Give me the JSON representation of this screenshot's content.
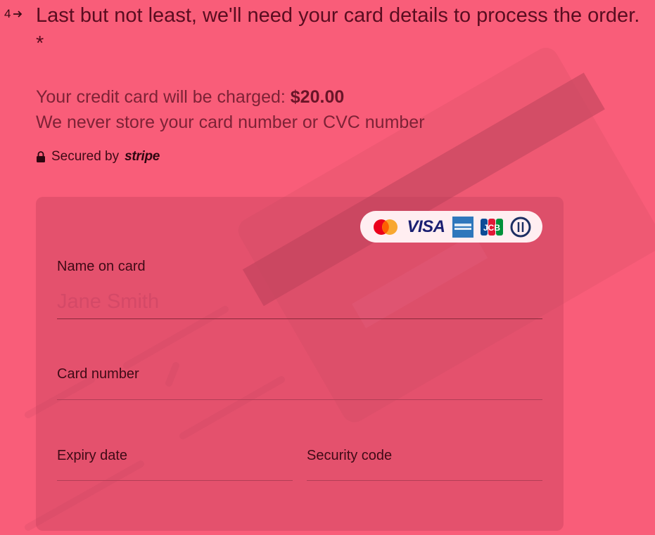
{
  "question": {
    "number": "4",
    "title": "Last but not least, we'll need your card details to process the order. *",
    "desc_charged": "Your credit card will be charged:",
    "amount": "$20.00",
    "desc_store": "We never store your card number or CVC number"
  },
  "secure": {
    "label": "Secured by",
    "provider": "stripe"
  },
  "brands": {
    "visa": "VISA",
    "jcb": "JCB"
  },
  "form": {
    "name_label": "Name on card",
    "name_placeholder": "Jane Smith",
    "number_label": "Card number",
    "expiry_label": "Expiry date",
    "security_label": "Security code"
  },
  "colors": {
    "background": "#f95d79",
    "text": "#5a0d20",
    "panel": "rgba(190,60,90,0.35)"
  }
}
